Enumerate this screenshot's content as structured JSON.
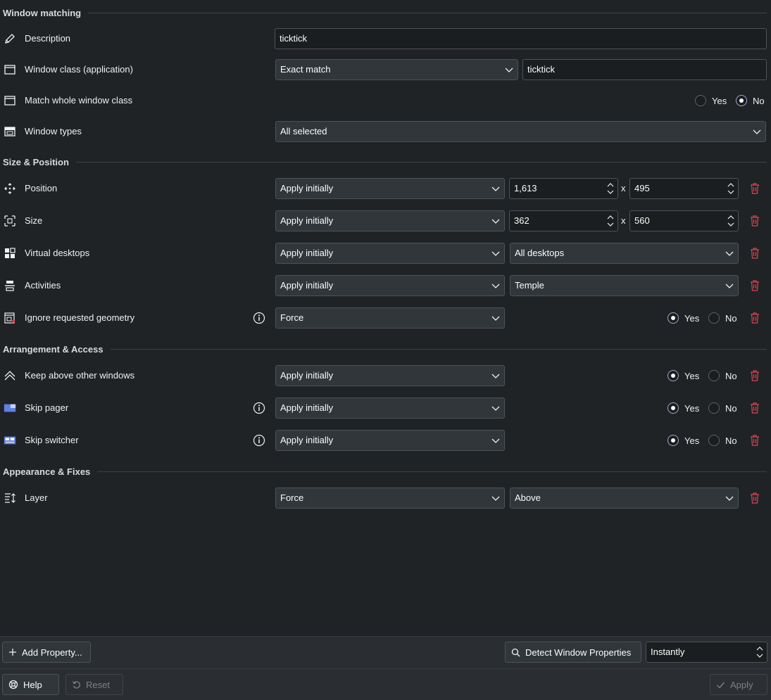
{
  "sections": {
    "window_matching": "Window matching",
    "size_position": "Size & Position",
    "arrangement_access": "Arrangement & Access",
    "appearance_fixes": "Appearance & Fixes"
  },
  "description": {
    "label": "Description",
    "value": "ticktick"
  },
  "window_class": {
    "label": "Window class (application)",
    "match": "Exact match",
    "value": "ticktick"
  },
  "whole_class": {
    "label": "Match whole window class",
    "yes": "Yes",
    "no": "No"
  },
  "window_types": {
    "label": "Window types",
    "value": "All selected"
  },
  "position": {
    "label": "Position",
    "policy": "Apply initially",
    "x": "1,613",
    "y": "495",
    "sep": "x"
  },
  "size": {
    "label": "Size",
    "policy": "Apply initially",
    "w": "362",
    "h": "560",
    "sep": "x"
  },
  "virtual_desktops": {
    "label": "Virtual desktops",
    "policy": "Apply initially",
    "value": "All desktops"
  },
  "activities": {
    "label": "Activities",
    "policy": "Apply initially",
    "value": "Temple"
  },
  "ignore_geometry": {
    "label": "Ignore requested geometry",
    "policy": "Force",
    "yes": "Yes",
    "no": "No"
  },
  "keep_above": {
    "label": "Keep above other windows",
    "policy": "Apply initially",
    "yes": "Yes",
    "no": "No"
  },
  "skip_pager": {
    "label": "Skip pager",
    "policy": "Apply initially",
    "yes": "Yes",
    "no": "No"
  },
  "skip_switcher": {
    "label": "Skip switcher",
    "policy": "Apply initially",
    "yes": "Yes",
    "no": "No"
  },
  "layer": {
    "label": "Layer",
    "policy": "Force",
    "value": "Above"
  },
  "footer": {
    "add_property": "Add Property...",
    "detect": "Detect Window Properties",
    "delay": "Instantly",
    "help": "Help",
    "reset": "Reset",
    "apply": "Apply"
  },
  "colors": {
    "accent": "#a9a3c7",
    "delete": "#da4453",
    "background": "#202326"
  }
}
